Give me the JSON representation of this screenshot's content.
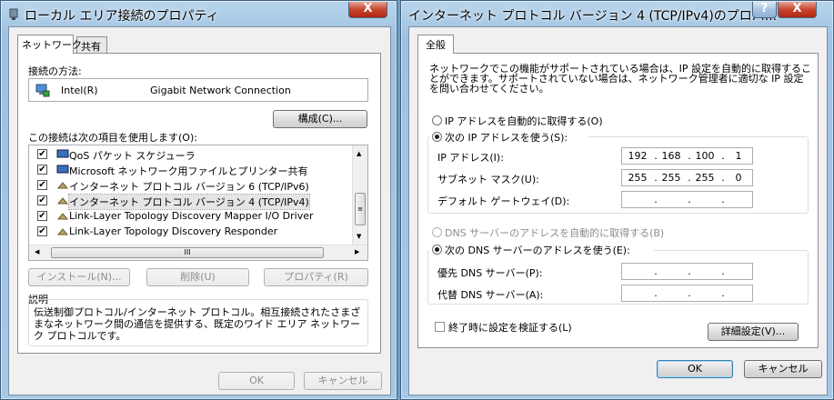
{
  "left_dialog": {
    "title": "ローカル エリア接続のプロパティ",
    "close_label": "X",
    "tabs": [
      {
        "label": "ネットワーク"
      },
      {
        "label": "共有"
      }
    ],
    "connect_using_label": "接続の方法:",
    "adapter_vendor": "Intel(R)",
    "adapter_name": "Gigabit Network Connection",
    "configure_button": "構成(C)...",
    "items_label": "この接続は次の項目を使用します(O):",
    "items": [
      {
        "label": "QoS パケット スケジューラ",
        "checked": true
      },
      {
        "label": "Microsoft ネットワーク用ファイルとプリンター共有",
        "checked": true
      },
      {
        "label": "インターネット プロトコル バージョン 6 (TCP/IPv6)",
        "checked": true
      },
      {
        "label": "インターネット プロトコル バージョン 4 (TCP/IPv4)",
        "checked": true
      },
      {
        "label": "Link-Layer Topology Discovery Mapper I/O Driver",
        "checked": true
      },
      {
        "label": "Link-Layer Topology Discovery Responder",
        "checked": true
      }
    ],
    "scroll_thumb": "III",
    "install_button": "インストール(N)...",
    "uninstall_button": "削除(U)",
    "properties_button": "プロパティ(R)",
    "description_label": "説明",
    "description_text": "伝送制御プロトコル/インターネット プロトコル。相互接続されたさまざまなネットワーク間の通信を提供する、既定のワイド エリア ネットワーク プロトコルです。",
    "ok_button": "OK",
    "cancel_button": "キャンセル"
  },
  "right_dialog": {
    "title": "インターネット プロトコル バージョン 4 (TCP/IPv4)のプロパ...",
    "help_label": "?",
    "close_label": "X",
    "tab_general": "全般",
    "intro_text": "ネットワークでこの機能がサポートされている場合は、IP 設定を自動的に取得することができます。サポートされていない場合は、ネットワーク管理者に適切な IP 設定を問い合わせてください。",
    "auto_ip_label": "IP アドレスを自動的に取得する(O)",
    "use_ip_label": "次の IP アドレスを使う(S):",
    "ip_address_label": "IP アドレス(I):",
    "ip_address": [
      "192",
      "168",
      "100",
      "1"
    ],
    "subnet_label": "サブネット マスク(U):",
    "subnet_mask": [
      "255",
      "255",
      "255",
      "0"
    ],
    "gateway_label": "デフォルト ゲートウェイ(D):",
    "auto_dns_label": "DNS サーバーのアドレスを自動的に取得する(B)",
    "use_dns_label": "次の DNS サーバーのアドレスを使う(E):",
    "preferred_dns_label": "優先 DNS サーバー(P):",
    "alternate_dns_label": "代替 DNS サーバー(A):",
    "validate_label": "終了時に設定を検証する(L)",
    "advanced_button": "詳細設定(V)...",
    "ok_button": "OK",
    "cancel_button": "キャンセル",
    "selected_ip_mode": "manual",
    "selected_dns_mode": "manual"
  }
}
